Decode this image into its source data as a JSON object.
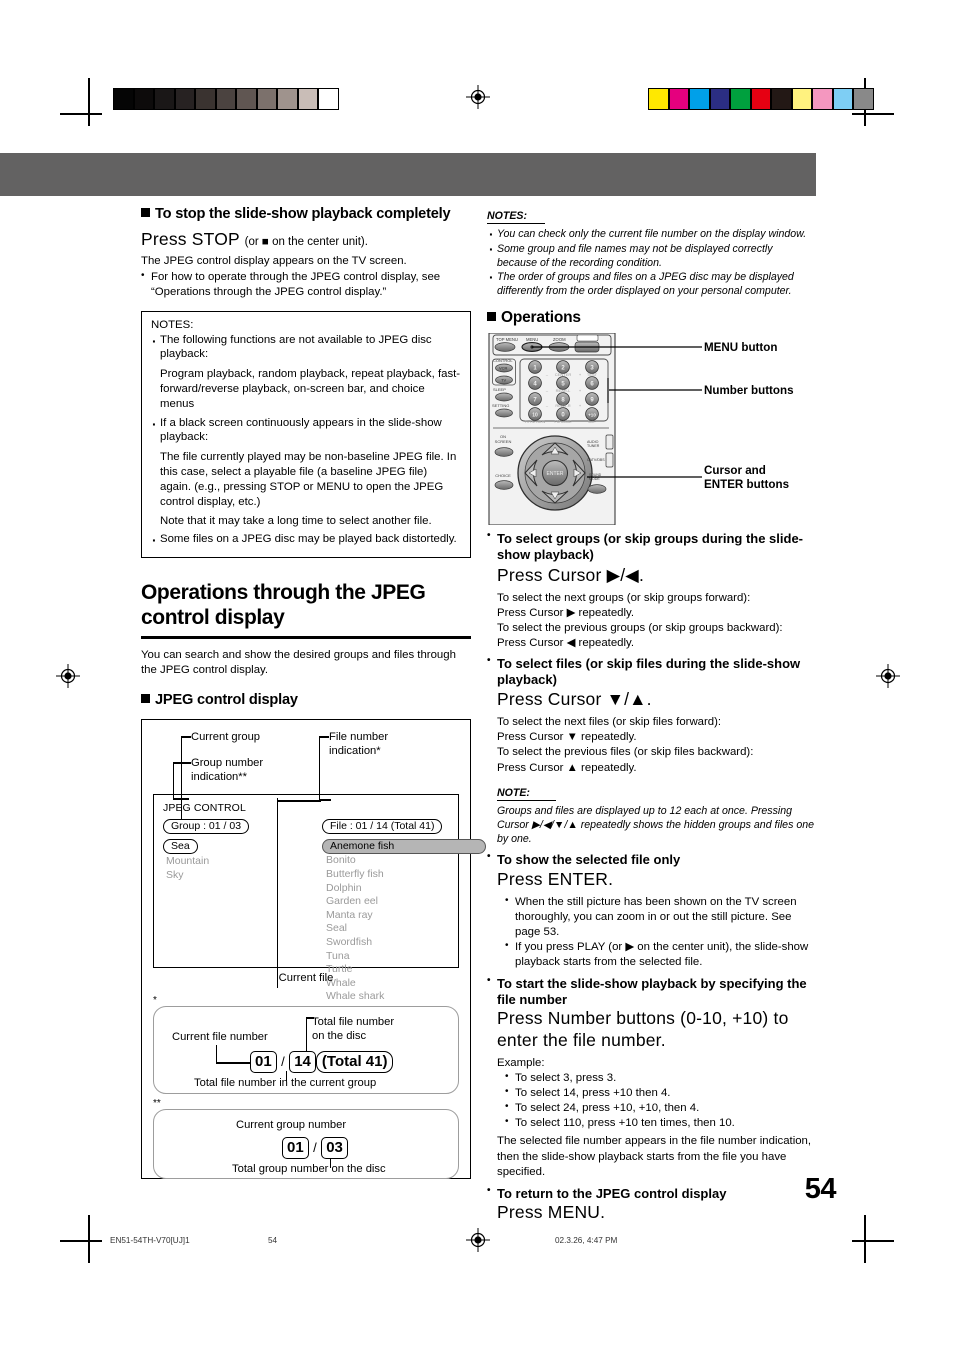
{
  "page": {
    "number": "54",
    "footer_left": "EN51-54TH-V70[UJ]1",
    "footer_page": "54",
    "footer_date": "02.3.26, 4:47 PM"
  },
  "printer_marks": {
    "grayscale_steps": [
      "#050505",
      "#0d0b0b",
      "#1a1717",
      "#272222",
      "#3a3330",
      "#4b4340",
      "#605652",
      "#7c716c",
      "#9f938d",
      "#c9bdb7",
      "#ffffff"
    ],
    "color_steps": [
      "#ffe800",
      "#e5007e",
      "#00a0e9",
      "#2b2e83",
      "#00a03e",
      "#e60012",
      "#231815",
      "#fff27f",
      "#f497bf",
      "#7ecef4",
      "#898989"
    ]
  },
  "header_band_color": "#636262",
  "left_column": {
    "stop_section": {
      "heading": "To stop the slide-show playback completely",
      "press_main": "Press STOP",
      "press_sub": "(or ■ on the center unit).",
      "body": "The JPEG control display appears on the TV screen.",
      "bullets": [
        "For how to operate through the JPEG control display, see “Operations through the JPEG control display.”"
      ]
    },
    "notes_box": {
      "title": "NOTES:",
      "items": [
        "The following functions are not available to JPEG disc playback:",
        "If a black screen continuously appears in the slide-show playback:"
      ],
      "para_1": "Program playback, random playback, repeat playback, fast-forward/reverse playback, on-screen bar, and choice menus",
      "para_2": "The file currently played may be non-baseline JPEG file. In this case, select a playable file (a baseline JPEG file) again. (e.g., pressing STOP or MENU to open the JPEG control display, etc.)",
      "para_3": "Note that it may take a long time to select another file.",
      "item_3": "Some files on a JPEG disc may be played back distortedly."
    },
    "section": {
      "title": "Operations through the JPEG control display",
      "intro": "You can search and show the desired groups and files through the JPEG control display.",
      "sub_heading": "JPEG control display"
    },
    "diagram": {
      "callout_current_group": "Current group",
      "callout_group_number": "Group number indication**",
      "callout_file_number": "File number indication*",
      "callout_current_file": "Current file",
      "screen_title": "JPEG CONTROL",
      "group_pill": "Group :  01 / 03",
      "file_pill": "File :  01 / 14 (Total 41)",
      "group_selected": "Sea",
      "groups": [
        "Mountain",
        "Sky"
      ],
      "file_selected": "Anemone fish",
      "files": [
        "Bonito",
        "Butterfly fish",
        "Dolphin",
        "Garden eel",
        "Manta ray",
        "Seal",
        "Swordfish",
        "Tuna",
        "Turtle",
        "Whale",
        "Whale shark"
      ],
      "file_detail": {
        "marker": "*",
        "label_current": "Current file number",
        "label_total_disc": "Total file number on the disc",
        "label_total_group": "Total file number in the current group",
        "value_current": "01",
        "slash": "/",
        "value_group_total": "14",
        "value_disc_total": "(Total 41)"
      },
      "group_detail": {
        "marker": "**",
        "label_current": "Current group number",
        "label_total": "Total group number on the disc",
        "value_current": "01",
        "slash": "/",
        "value_total": "03"
      }
    }
  },
  "right_column": {
    "notes": {
      "title": "NOTES:",
      "items": [
        "You can check only the current file number on the display window.",
        "Some group and file names may not be displayed correctly because of the recording condition.",
        "The order of groups and files on a JPEG disc may be displayed differently from the order displayed on your personal computer."
      ]
    },
    "operations_heading": "Operations",
    "remote": {
      "callout_menu": "MENU button",
      "callout_numbers": "Number buttons",
      "callout_cursor": "Cursor and ENTER buttons",
      "top_row": [
        "TOP MENU",
        "MENU",
        "ZOOM",
        "SUBTITLE"
      ],
      "left_buttons": [
        "CONTROL",
        "VCR",
        "TV",
        "SLEEP",
        "SETTING",
        "ON SCREEN",
        "CHOICE"
      ],
      "numbers": [
        "1",
        "2",
        "3",
        "4",
        "5",
        "6",
        "7",
        "8",
        "9",
        "10",
        "0",
        "+10"
      ],
      "number_sublabels": [
        "CENTER",
        "TEST",
        "REAR-L",
        "REAR-R",
        "TV RETURN",
        "FM MODE",
        "100+"
      ],
      "enter_label": "ENTER",
      "right_labels": [
        "AUDIO TUNER",
        "CATV/DBS",
        "MODE"
      ]
    },
    "sections": [
      {
        "heading": "To select groups (or skip groups during the slide-show playback)",
        "press": "Press Cursor ▶/◀.",
        "lines": [
          "To select the next groups (or skip groups forward):",
          "Press Cursor ▶ repeatedly.",
          "To select the previous groups (or skip groups backward):",
          "Press Cursor ◀ repeatedly."
        ]
      },
      {
        "heading": "To select files (or skip files during the slide-show playback)",
        "press": "Press Cursor ▼/▲.",
        "lines": [
          "To select the next files (or skip files forward):",
          "Press Cursor ▼ repeatedly.",
          "To select the previous files (or skip files backward):",
          "Press Cursor ▲ repeatedly."
        ]
      }
    ],
    "note_single": {
      "title": "NOTE:",
      "text": "Groups and files are displayed up to 12 each at once. Pressing Cursor ▶/◀/▼/▲ repeatedly shows the hidden groups and files one by one."
    },
    "show_file": {
      "heading": "To show the selected file only",
      "press": "Press ENTER.",
      "bullets": [
        "When the still picture has been shown on the TV screen thoroughly, you can zoom in or out the still picture. See page 53.",
        "If you press PLAY (or ▶ on the center unit), the slide-show playback starts from the selected file."
      ]
    },
    "start_by_number": {
      "heading": "To start the slide-show playback by specifying the file number",
      "press": "Press Number buttons (0-10, +10) to enter the file number.",
      "example_label": "Example:",
      "examples": [
        "To select 3, press 3.",
        "To select 14, press +10 then 4.",
        "To select 24, press +10, +10, then 4.",
        "To select 110, press +10 ten times, then 10."
      ],
      "body": "The selected file number appears in the file number indication, then the slide-show playback starts from the file you have specified."
    },
    "return_display": {
      "heading": "To return to the JPEG control display",
      "press": "Press MENU."
    }
  }
}
